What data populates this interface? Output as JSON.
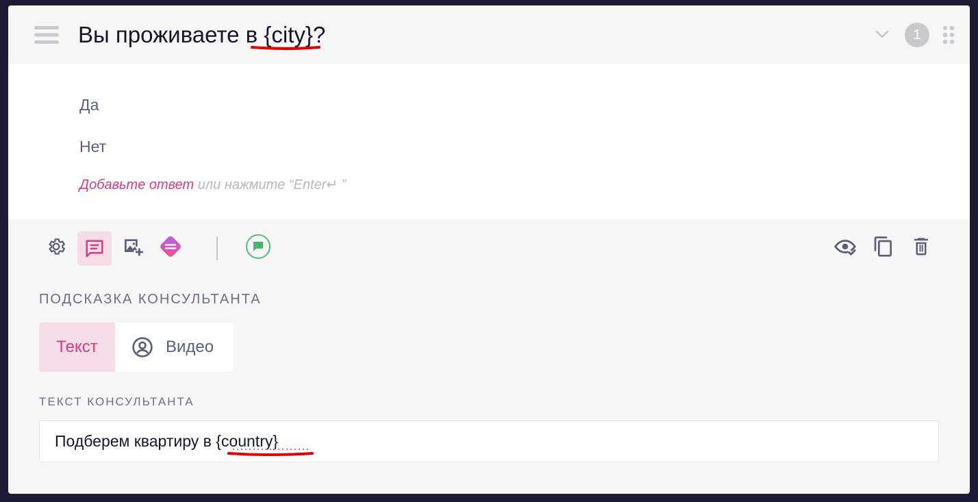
{
  "question": {
    "title": "Вы проживаете в {city}?",
    "number": "1"
  },
  "answers": [
    "Да",
    "Нет"
  ],
  "add_answer": {
    "link": "Добавьте ответ",
    "hint": " или нажмите “Enter↵ ”"
  },
  "hint_section": {
    "title": "ПОДСКАЗКА КОНСУЛЬТАНТА",
    "tabs": {
      "text": "Текст",
      "video": "Видео"
    }
  },
  "consultant_section": {
    "title": "ТЕКСТ КОНСУЛЬТАНТА",
    "value": "Подберем квартиру в {country}"
  },
  "colors": {
    "accent": "#d23c82",
    "active_bg": "#f6dce7",
    "icon_gray": "#5b5e78",
    "chat_green": "#48b56a",
    "error_red": "#e00000"
  },
  "icons": {
    "list": "list-icon",
    "chevron": "chevron-down-icon",
    "drag": "drag-handle-icon",
    "settings": "gear-icon",
    "comment": "comment-icon",
    "image": "add-image-icon",
    "logic": "logic-icon",
    "chat": "chat-bubble-icon",
    "preview": "eye-check-icon",
    "copy": "copy-icon",
    "delete": "trash-icon",
    "user": "user-circle-icon"
  }
}
